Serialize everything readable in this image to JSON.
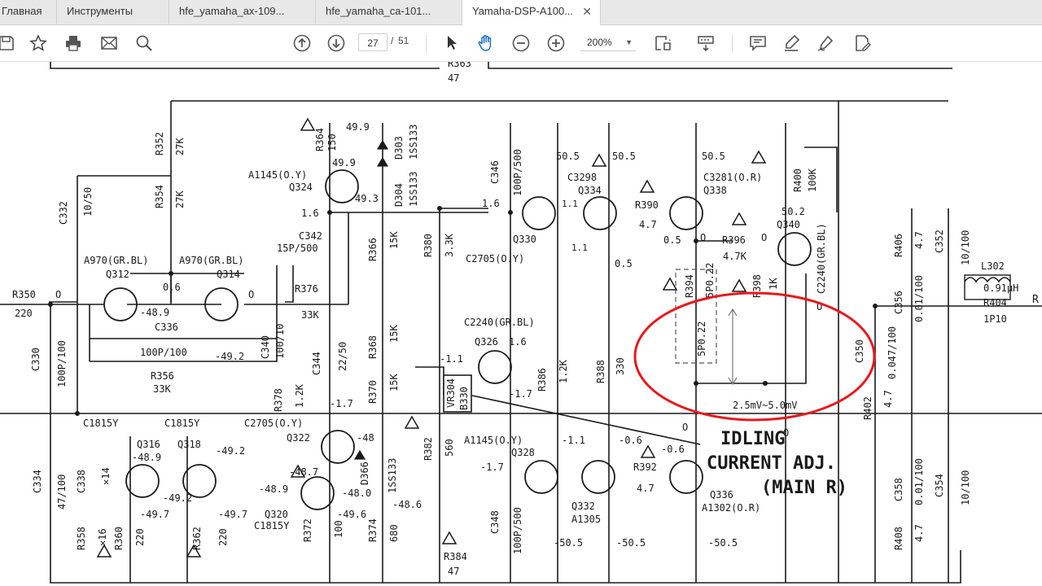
{
  "tabs": [
    {
      "label": "Главная"
    },
    {
      "label": "Инструменты"
    },
    {
      "label": "hfe_yamaha_ax-109..."
    },
    {
      "label": "hfe_yamaha_ca-101..."
    },
    {
      "label": "Yamaha-DSP-A100..."
    }
  ],
  "toolbar": {
    "page_current": "27",
    "page_separator": "/",
    "page_total": "51",
    "zoom": "200%"
  },
  "icons": [
    "save-icon",
    "bookmark-star-icon",
    "print-icon",
    "email-icon",
    "search-icon",
    "prev-page-icon",
    "next-page-icon",
    "select-arrow-icon",
    "hand-tool-icon",
    "zoom-out-icon",
    "zoom-in-icon",
    "page-display-icon",
    "scroll-mode-icon",
    "comment-icon",
    "highlight-icon",
    "sign-icon",
    "edit-pdf-icon"
  ],
  "accent_color": "#e8191c",
  "schematic": {
    "labels": {
      "r363": "R363",
      "v47a": "47",
      "r352": "R352",
      "v27k_a": "27K",
      "r354": "R354",
      "v27k_b": "27K",
      "c332": "C332",
      "v10_50": "10/50",
      "r364": "R364",
      "v150": "150",
      "v49_9a": "49.9",
      "v49_9b": "49.9",
      "v49_3": "49.3",
      "d303": "D303",
      "d304": "D304",
      "is133a": "1SS133",
      "is133b": "1SS133",
      "a1145a": "A1145(O.Y)",
      "q324": "Q324",
      "v1_6a": "1.6",
      "c342": "C342",
      "v15p500": "15P/500",
      "r366": "R366",
      "v15k_a": "15K",
      "r380": "R380",
      "v3_3k": "3.3K",
      "c346": "C346",
      "v100p500": "100P/500",
      "v1_6b": "1.6",
      "q330": "Q330",
      "c2705a": "C2705(O.Y)",
      "v50_5a": "50.5",
      "v50_5b": "50.5",
      "c3298": "C3298",
      "q334": "Q334",
      "v1_1a": "1.1",
      "v1_1b": "1.1",
      "r390": "R390",
      "v4_7a": "4.7",
      "v0_5a": "0.5",
      "v0_5b": "0.5",
      "v50_5c": "50.5",
      "c3281": "C3281(O.R)",
      "q338": "Q338",
      "r396": "R396",
      "v4_7k": "4.7K",
      "r400": "R400",
      "v100k": "100K",
      "v50_2": "50.2",
      "q340": "Q340",
      "c2240a": "C2240(GR.BL)",
      "r394": "R394",
      "v5p0_22a": "5P0.22",
      "r398": "R398",
      "v1k": "1K",
      "v5p0_22b": "5P0.22",
      "a970a": "A970(GR.BL)",
      "q312": "Q312",
      "v0_6": "0.6",
      "a970b": "A970(GR.BL)",
      "q314": "Q314",
      "r350": "R350",
      "v220a": "220",
      "v48_9a": "-48.9",
      "c336": "C336",
      "v100p100": "100P/100",
      "r356": "R356",
      "v33k_a": "33K",
      "v49_2a": "-49.2",
      "c330": "C330",
      "v100p100b": "100P/100",
      "r376": "R376",
      "v33k_b": "33K",
      "c340": "C340",
      "v100_10": "100/10",
      "c344": "C344",
      "v22_50": "22/50",
      "r378": "R378",
      "v1_2k_a": "1.2K",
      "r368": "R368",
      "v15k_b": "15K",
      "r370": "R370",
      "v15k_c": "15K",
      "v1_7a": "-1.7",
      "c2240b": "C2240(GR.BL)",
      "q326": "Q326",
      "v1_6c": "1.6",
      "v1_1c": "-1.1",
      "v1_7b": "-1.7",
      "vr304": "VR304",
      "b330": "B330",
      "r386": "R386",
      "v1_2k_b": "1.2K",
      "r388": "R388",
      "v330": "330",
      "c1815a": "C1815Y",
      "c1815b": "C1815Y",
      "q316": "Q316",
      "q318": "Q318",
      "v48_9b": "-48.9",
      "v49_2b": "-49.2",
      "v49_2c": "-49.2",
      "c2705b": "C2705(O.Y)",
      "q322": "Q322",
      "v48a": "-48",
      "v48_7": "-48.7",
      "d366": "D366",
      "is133c": "1SS133",
      "v48_9c": "-48.9",
      "v48_0": "-48.0",
      "v49_6": "-49.6",
      "q320": "Q320",
      "c1815c": "C1815Y",
      "r382": "R382",
      "v560": "560",
      "a1145b": "A1145(O.Y)",
      "v1_7c": "-1.7",
      "q328": "Q328",
      "v1_1d": "-1.1",
      "v0_6b": "-0.6",
      "v0_6c": "-0.6",
      "r392": "R392",
      "v4_7b": "4.7",
      "q332": "Q332",
      "a1305": "A1305",
      "q336": "Q336",
      "a1302": "A1302(O.R)",
      "c348": "C348",
      "v100p500b": "100P/500",
      "v50_5d": "-50.5",
      "v50_5e": "-50.5",
      "v50_5f": "-50.5",
      "v48_6": "-48.6",
      "r372": "R372",
      "v100": "100",
      "r374": "R374",
      "v680": "680",
      "r384": "R384",
      "v47b": "47",
      "c334": "C334",
      "v47_100": "47/100",
      "c338": "C338",
      "x14": "✕14",
      "r358": "R358",
      "x16": "✕16",
      "r360": "R360",
      "v220b": "220",
      "r362": "R362",
      "v220c": "220",
      "v49_7a": "-49.7",
      "v49_7b": "-49.7",
      "r406": "R406",
      "v4_7c": "4.7",
      "c352": "C352",
      "v10_100a": "10/100",
      "c356": "C356",
      "v0_01_100a": "0.01/100",
      "l302": "L302",
      "v0_91uh": "0.91μH",
      "r404": "R404",
      "v1p10": "1P10",
      "c350": "C350",
      "v0_047_100": "0.047/100",
      "r402": "R402",
      "v4_7d": "4.7",
      "c358": "C358",
      "v0_01_100b": "0.01/100",
      "c354": "C354",
      "v10_100b": "10/100",
      "r408": "R408",
      "v4_7e": "4.7",
      "adj_range": "2.5mV~5.0mV",
      "zero_a": "O",
      "zero_b": "O",
      "zero_c": "O",
      "zero_d": "O",
      "zero_e": "O",
      "zero_f": "O",
      "zero_g": "O",
      "idling1": "IDLING",
      "idling2": "CURRENT ADJ.",
      "idling3": "(MAIN R)",
      "edge_r": "R"
    }
  }
}
